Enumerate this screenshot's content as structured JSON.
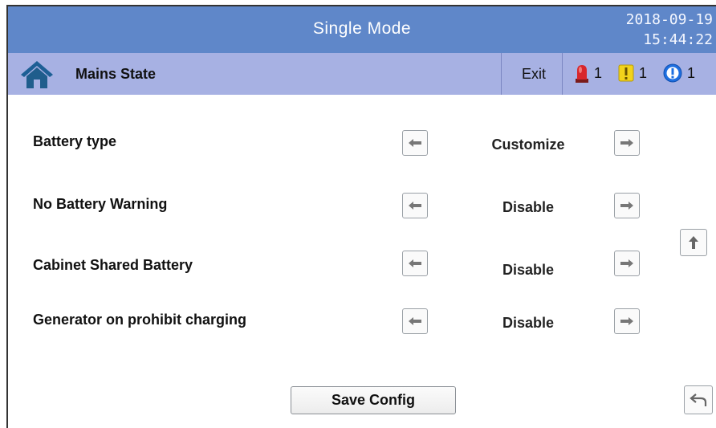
{
  "header": {
    "title": "Single Mode",
    "date": "2018-09-19",
    "time": "15:44:22"
  },
  "nav": {
    "home_icon": "home-icon",
    "title": "Mains State",
    "exit_label": "Exit",
    "alarms": [
      {
        "icon": "alarm-siren-icon",
        "count": "1",
        "color": "#d8262b"
      },
      {
        "icon": "warning-icon",
        "count": "1",
        "color": "#f2d31b"
      },
      {
        "icon": "info-icon",
        "count": "1",
        "color": "#1e6fe0"
      }
    ]
  },
  "settings": [
    {
      "label": "Battery type",
      "value": "Customize"
    },
    {
      "label": "No Battery Warning",
      "value": "Disable"
    },
    {
      "label": "Cabinet Shared Battery",
      "value": "Disable"
    },
    {
      "label": "Generator on prohibit charging",
      "value": "Disable"
    }
  ],
  "footer": {
    "save_label": "Save Config"
  }
}
